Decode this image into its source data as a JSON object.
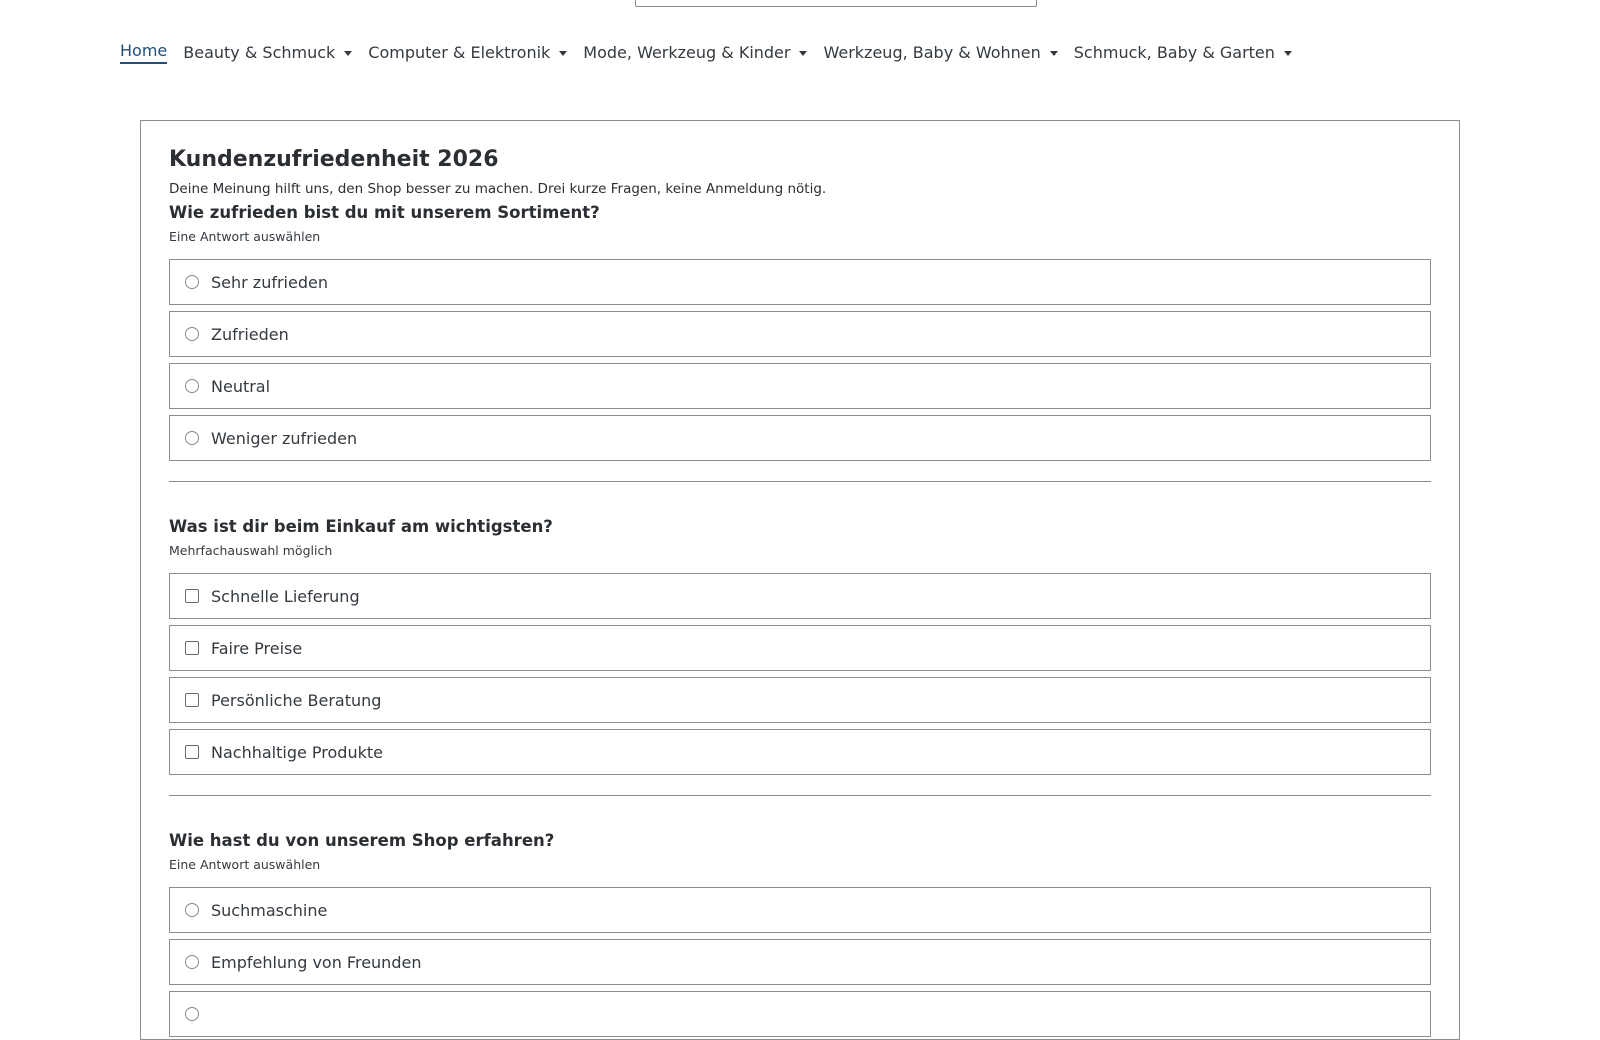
{
  "search": {
    "placeholder": ""
  },
  "nav": {
    "items": [
      {
        "label": "Home",
        "active": true,
        "dropdown": false
      },
      {
        "label": "Beauty & Schmuck",
        "active": false,
        "dropdown": true
      },
      {
        "label": "Computer & Elektronik",
        "active": false,
        "dropdown": true
      },
      {
        "label": "Mode, Werkzeug & Kinder",
        "active": false,
        "dropdown": true
      },
      {
        "label": "Werkzeug, Baby & Wohnen",
        "active": false,
        "dropdown": true
      },
      {
        "label": "Schmuck, Baby & Garten",
        "active": false,
        "dropdown": true
      }
    ]
  },
  "survey": {
    "title": "Kundenzufriedenheit 2026",
    "intro": "Deine Meinung hilft uns, den Shop besser zu machen. Drei kurze Fragen, keine Anmeldung nötig.",
    "questions": [
      {
        "title": "Wie zufrieden bist du mit unserem Sortiment?",
        "hint": "Eine Antwort auswählen",
        "type": "radio",
        "options": [
          "Sehr zufrieden",
          "Zufrieden",
          "Neutral",
          "Weniger zufrieden"
        ]
      },
      {
        "title": "Was ist dir beim Einkauf am wichtigsten?",
        "hint": "Mehrfachauswahl möglich",
        "type": "checkbox",
        "options": [
          "Schnelle Lieferung",
          "Faire Preise",
          "Persönliche Beratung",
          "Nachhaltige Produkte"
        ]
      },
      {
        "title": "Wie hast du von unserem Shop erfahren?",
        "hint": "Eine Antwort auswählen",
        "type": "radio",
        "options": [
          "Suchmaschine",
          "Empfehlung von Freunden",
          ""
        ]
      }
    ]
  },
  "colors": {
    "nav_active": "#1f4f7a",
    "text": "#343a40",
    "border": "#8d8d8d"
  }
}
